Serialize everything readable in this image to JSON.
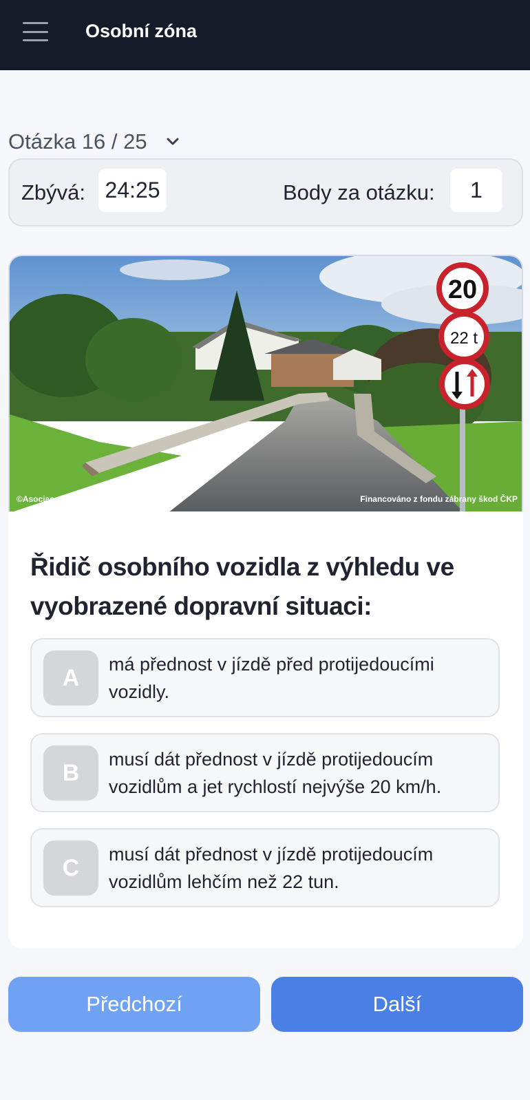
{
  "header": {
    "title": "Osobní zóna"
  },
  "question_nav": {
    "label": "Otázka 16 / 25"
  },
  "status": {
    "remaining_label": "Zbývá:",
    "remaining_value": "24:25",
    "points_label": "Body za otázku:",
    "points_value": "1"
  },
  "image": {
    "credit_left": "©Asociace autoškol ČR 2021",
    "credit_right": "Financováno z fondu zábrany škod ČKP",
    "sign_speed": "20",
    "sign_weight": "22 t"
  },
  "question": {
    "text": "Řidič osobního vozidla z výhledu ve vyobrazené dopravní situaci:"
  },
  "answers": [
    {
      "letter": "A",
      "text": "má přednost v jízdě před protijedoucími vozidly."
    },
    {
      "letter": "B",
      "text": "musí dát přednost v jízdě protijedoucím vozidlům a jet rychlostí nejvýše 20 km/h."
    },
    {
      "letter": "C",
      "text": "musí dát přednost v jízdě protijedoucím vozidlům lehčím než 22 tun."
    }
  ],
  "buttons": {
    "prev_label": "Předchozí",
    "next_label": "Další"
  },
  "colors": {
    "header_bg": "#151b28",
    "prev_button": "#6fa2f2",
    "next_button": "#4a7fe6",
    "sign_red": "#c8232c"
  },
  "icons": {
    "menu": "hamburger-icon",
    "dropdown": "chevron-down-icon"
  }
}
